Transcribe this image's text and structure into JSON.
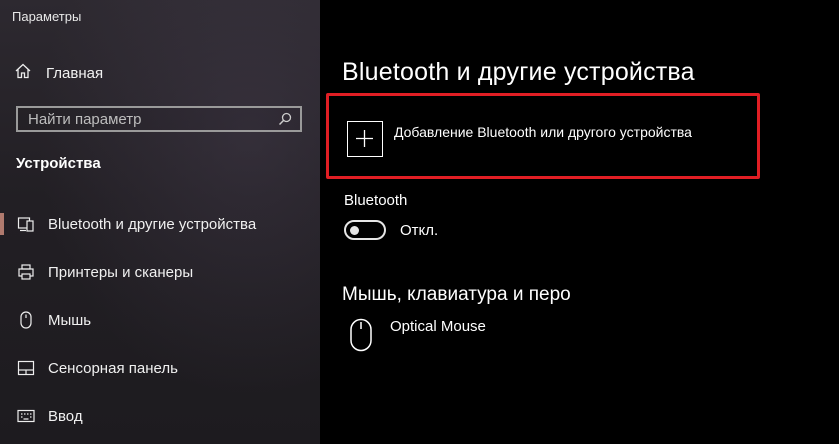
{
  "window": {
    "title": "Параметры"
  },
  "sidebar": {
    "home_label": "Главная",
    "search_placeholder": "Найти параметр",
    "section_title": "Устройства",
    "items": [
      {
        "label": "Bluetooth и другие устройства",
        "icon": "bluetooth-devices-icon",
        "active": true
      },
      {
        "label": "Принтеры и сканеры",
        "icon": "printer-icon",
        "active": false
      },
      {
        "label": "Мышь",
        "icon": "mouse-icon",
        "active": false
      },
      {
        "label": "Сенсорная панель",
        "icon": "touchpad-icon",
        "active": false
      },
      {
        "label": "Ввод",
        "icon": "keyboard-icon",
        "active": false
      }
    ]
  },
  "main": {
    "title": "Bluetooth и другие устройства",
    "add_device_label": "Добавление Bluetooth или другого устройства",
    "bluetooth": {
      "label": "Bluetooth",
      "state_label": "Откл.",
      "on": false
    },
    "devices_section_title": "Мышь, клавиатура и перо",
    "devices": [
      {
        "name": "Optical Mouse",
        "icon": "mouse-icon"
      }
    ]
  },
  "colors": {
    "highlight_border": "#e01e24",
    "active_indicator": "#b07a6e",
    "main_background": "#000000"
  }
}
